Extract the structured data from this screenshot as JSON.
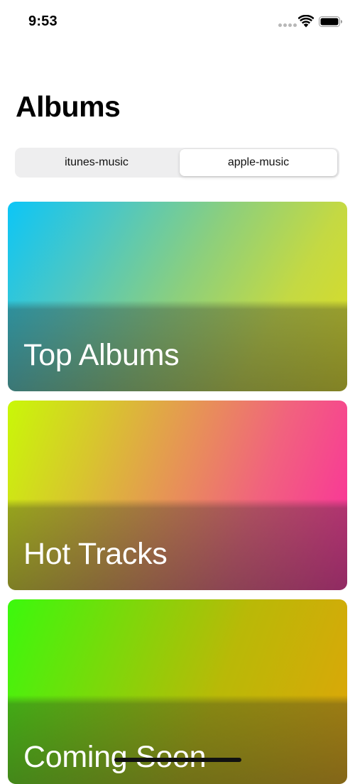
{
  "status_bar": {
    "time": "9:53"
  },
  "header": {
    "title": "Albums"
  },
  "segmented_control": {
    "options": [
      "itunes-music",
      "apple-music"
    ],
    "selected": "apple-music"
  },
  "cards": [
    {
      "title": "Top Albums"
    },
    {
      "title": "Hot Tracks"
    },
    {
      "title": "Coming Soon"
    }
  ],
  "colors": {
    "card_1": [
      "#0cc6f7",
      "#dedd20"
    ],
    "card_2": [
      "#c9f807",
      "#fb2c9e"
    ],
    "card_3": [
      "#3bf90d",
      "#e0a408"
    ]
  },
  "icons": [
    "signal-dots-icon",
    "wifi-icon",
    "battery-icon"
  ]
}
